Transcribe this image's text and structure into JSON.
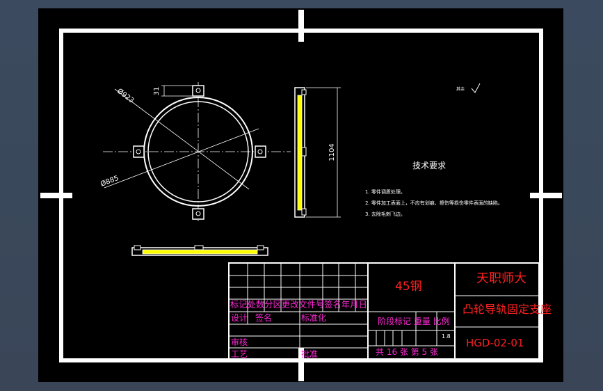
{
  "dimensions": {
    "d_outer": "Ø923",
    "d_inner": "Ø885",
    "lug": "31",
    "height": "1104"
  },
  "notes": {
    "heading": "技术要求",
    "items": [
      "1. 零件调质处理。",
      "2. 零件加工表面上，不应有划痕、擦伤等损伤零件表面的缺陷。",
      "3. 去除毛刺飞边。"
    ]
  },
  "roughness": "其余",
  "title_block": {
    "material": "45钢",
    "school": "天职师大",
    "part_name": "凸轮导轨固定支座",
    "drawing_no": "HGD-02-01",
    "revision_header": "标记处数分区更改文件号签名年月日",
    "design": "设计",
    "design_sign": "签名",
    "standardize": "标准化",
    "review": "审核",
    "process": "工艺",
    "approve": "批准",
    "stage_header": "阶段标记 重量 比例",
    "scale": "1.8",
    "sheets": "共 16 张 第 5 张"
  }
}
